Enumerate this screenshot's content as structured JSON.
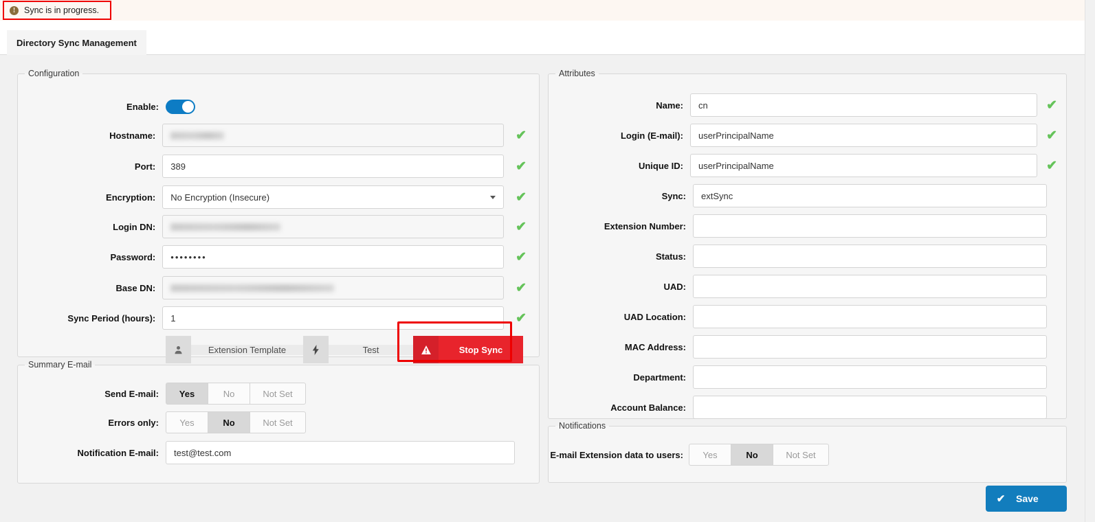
{
  "alert": {
    "icon": "exclamation-circle-icon",
    "message": "Sync is in progress."
  },
  "tab": {
    "label": "Directory Sync Management"
  },
  "configuration": {
    "legend": "Configuration",
    "fields": {
      "enable": {
        "label": "Enable:",
        "value": "",
        "state": "on"
      },
      "hostname": {
        "label": "Hostname:",
        "value": "",
        "redacted": true
      },
      "port": {
        "label": "Port:",
        "value": "389"
      },
      "encryption": {
        "label": "Encryption:",
        "value": "No Encryption (Insecure)"
      },
      "login_dn": {
        "label": "Login DN:",
        "value": "",
        "redacted": true
      },
      "password": {
        "label": "Password:",
        "value": "••••••••"
      },
      "base_dn": {
        "label": "Base DN:",
        "value": "",
        "redacted": true
      },
      "sync_period": {
        "label": "Sync Period (hours):",
        "value": "1"
      }
    },
    "buttons": {
      "extension_template": {
        "label": "Extension Template",
        "icon": "user-icon"
      },
      "test": {
        "label": "Test",
        "icon": "lightning-bolt-icon"
      },
      "stop_sync": {
        "label": "Stop Sync",
        "icon": "warning-triangle-icon"
      }
    },
    "validation_mark": "✔"
  },
  "summary_email": {
    "legend": "Summary E-mail",
    "send_email": {
      "label": "Send E-mail:",
      "options": [
        "Yes",
        "No",
        "Not Set"
      ],
      "selected": "Yes"
    },
    "errors_only": {
      "label": "Errors only:",
      "options": [
        "Yes",
        "No",
        "Not Set"
      ],
      "selected": "No"
    },
    "notification_email": {
      "label": "Notification E-mail:",
      "value": "test@test.com"
    }
  },
  "attributes": {
    "legend": "Attributes",
    "rows": [
      {
        "label": "Name:",
        "value": "cn",
        "valid": true
      },
      {
        "label": "Login (E-mail):",
        "value": "userPrincipalName",
        "valid": true
      },
      {
        "label": "Unique ID:",
        "value": "userPrincipalName",
        "valid": true
      },
      {
        "label": "Sync:",
        "value": "extSync",
        "valid": false
      },
      {
        "label": "Extension Number:",
        "value": "",
        "valid": false
      },
      {
        "label": "Status:",
        "value": "",
        "valid": false
      },
      {
        "label": "UAD:",
        "value": "",
        "valid": false
      },
      {
        "label": "UAD Location:",
        "value": "",
        "valid": false
      },
      {
        "label": "MAC Address:",
        "value": "",
        "valid": false
      },
      {
        "label": "Department:",
        "value": "",
        "valid": false
      },
      {
        "label": "Account Balance:",
        "value": "",
        "valid": false
      }
    ],
    "validation_mark": "✔"
  },
  "notifications": {
    "legend": "Notifications",
    "email_extension_data": {
      "label": "E-mail Extension data to users:",
      "options": [
        "Yes",
        "No",
        "Not Set"
      ],
      "selected": "No"
    }
  },
  "footer": {
    "save": {
      "label": "Save",
      "icon": "check-icon",
      "color": "#127dbd"
    }
  },
  "colors": {
    "accent": "#127dbd",
    "toggle_on": "#0d7cc4",
    "danger": "#e8242c",
    "highlight_ring": "#ee0000",
    "valid_check": "#65c35a"
  }
}
